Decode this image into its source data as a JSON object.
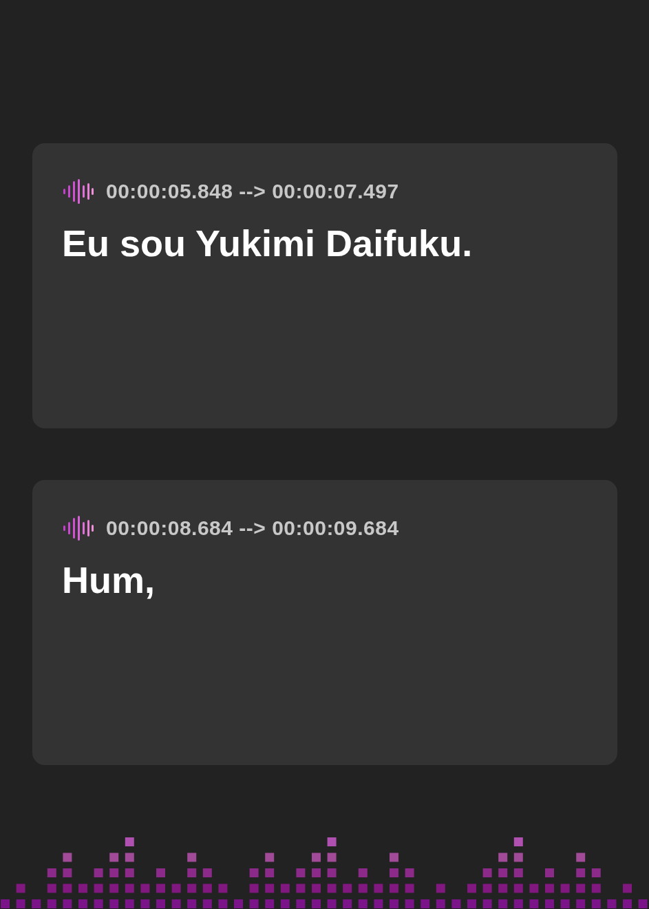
{
  "cues": [
    {
      "timing": "00:00:05.848 --> 00:00:07.497",
      "text": "Eu sou Yukimi Daifuku."
    },
    {
      "timing": "00:00:08.684 --> 00:00:09.684",
      "text": "Hum,"
    }
  ]
}
